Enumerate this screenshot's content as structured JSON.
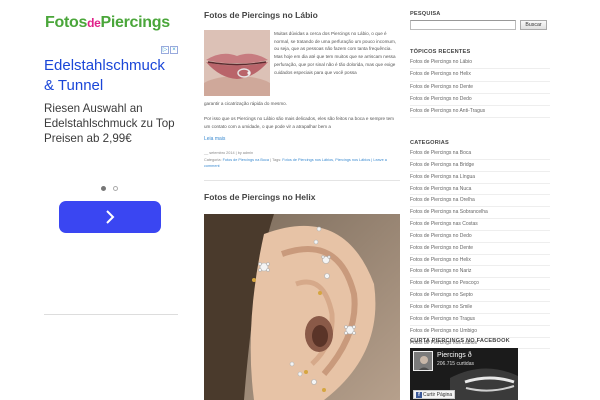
{
  "logo": {
    "part1": "Fotos",
    "part2": "de",
    "part3": "Piercings"
  },
  "ad": {
    "title": "Edelstahlschmuck & Tunnel",
    "description": "Riesen Auswahl an Edelstahlschmuck zu Top Preisen ab 2,99€"
  },
  "post1": {
    "title": "Fotos de Piercings no Lábio",
    "excerpt_side": "Muitas dúvidas a cerca dos Piercings no Lábio, o que é normal, se tratando de uma perfuração um pouco incomum, ou seja, que as pessoas não fazem com tanta frequência. Mas hoje em dia até que tem muitos que se arriscam nessa perfuração, que por sinal não é tão dolorida, mas que exige cuidados especiais para que você possa",
    "excerpt_full1": "garantir a cicatrização rápida do mesmo.",
    "excerpt_full2": "Por isso que os Piercings no Lábio são mais delicados, eles são feitos na boca e sempre tem um contato com a umidade, o que pode vir a atrapalhar bem a",
    "read_more": "Leia mais",
    "date_line": "__ setembro 2014 | by admin",
    "cat_label": "Categoria:",
    "cat_value": "Fotos de Piercings na Boca",
    "tags_label": "| Tags:",
    "tags_value": "Fotos de Piercings nos Lábios, Piercings nos Lábios",
    "comment_link": "| Leave a comment"
  },
  "post2": {
    "title": "Fotos de Piercings no Helix"
  },
  "sidebar": {
    "search_heading": "PESQUISA",
    "search_value": "",
    "search_button": "Buscar",
    "recent_heading": "TÓPICOS RECENTES",
    "recent": [
      "Fotos de Piercings no Lábio",
      "Fotos de Piercings no Helix",
      "Fotos de Piercings no Dente",
      "Fotos de Piercings no Dedo",
      "Fotos de Piercings no Anti-Tragus"
    ],
    "categories_heading": "CATEGORIAS",
    "categories": [
      "Fotos de Piercings na Boca",
      "Fotos de Piercings na Bridge",
      "Fotos de Piercings na Língua",
      "Fotos de Piercings na Nuca",
      "Fotos de Piercings na Orelha",
      "Fotos de Piercings na Sobrancelha",
      "Fotos de Piercings nas Costas",
      "Fotos de Piercings no Dedo",
      "Fotos de Piercings no Dente",
      "Fotos de Piercings no Helix",
      "Fotos de Piercings no Nariz",
      "Fotos de Piercings no Pescoço",
      "Fotos de Piercings no Septo",
      "Fotos de Piercings no Smile",
      "Fotos de Piercings no Tragus",
      "Fotos de Piercings no Umbigo",
      "Fotos de Piercings nos Lábios"
    ],
    "facebook_heading": "CURTA PIERCINGS NO FACEBOOK",
    "fb_page_name": "Piercings ð",
    "fb_likes": "206.715 curtidas",
    "fb_like_button": "Curtir Página"
  }
}
